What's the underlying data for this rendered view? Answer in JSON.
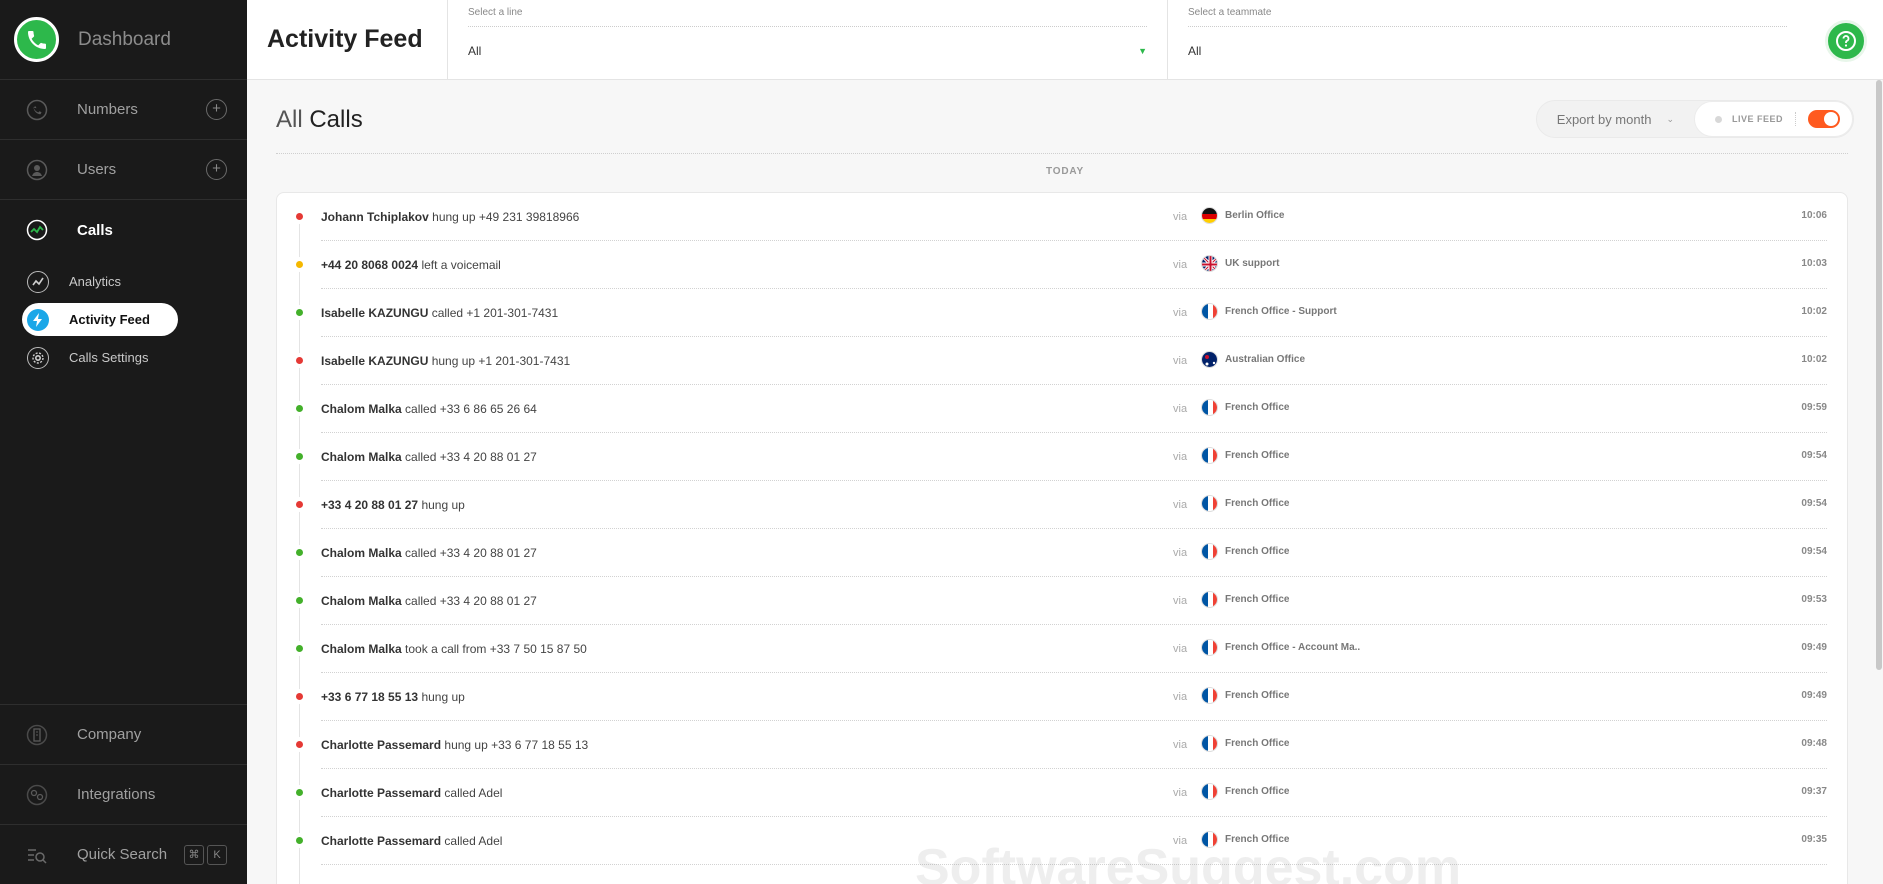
{
  "sidebar": {
    "brand": "Dashboard",
    "nav": {
      "numbers": "Numbers",
      "users": "Users",
      "calls": "Calls",
      "analytics": "Analytics",
      "activity_feed": "Activity Feed",
      "calls_settings": "Calls Settings",
      "company": "Company",
      "integrations": "Integrations",
      "quick_search": "Quick Search"
    },
    "shortcut_keys": [
      "⌘",
      "K"
    ]
  },
  "header": {
    "title": "Activity Feed",
    "line_filter": {
      "label": "Select a line",
      "value": "All"
    },
    "teammate_filter": {
      "label": "Select a teammate",
      "value": "All"
    }
  },
  "main": {
    "title_prefix": "All",
    "title_main": "Calls",
    "export_label": "Export by month",
    "live_feed_label": "LIVE FEED",
    "live_feed_on": true,
    "section_label": "TODAY",
    "watermark": "SoftwareSuggest.com"
  },
  "colors": {
    "accent_green": "#2db84b",
    "hung_up_red": "#e53935",
    "voicemail_yellow": "#f5b800",
    "called_green": "#43b02a",
    "toggle_orange": "#ff5a1f"
  },
  "calls": [
    {
      "status": "red",
      "actor": "Johann Tchiplakov",
      "action": "hung up +49 231 39818966",
      "via": "via",
      "flag": "de",
      "line": "Berlin Office",
      "time": "10:06"
    },
    {
      "status": "yellow",
      "actor": "+44 20 8068 0024",
      "action": "left a voicemail",
      "via": "via",
      "flag": "gb",
      "line": "UK support",
      "time": "10:03"
    },
    {
      "status": "green",
      "actor": "Isabelle KAZUNGU",
      "action": "called +1 201-301-7431",
      "via": "via",
      "flag": "fr",
      "line": "French Office - Support",
      "time": "10:02"
    },
    {
      "status": "red",
      "actor": "Isabelle KAZUNGU",
      "action": "hung up +1 201-301-7431",
      "via": "via",
      "flag": "au",
      "line": "Australian Office",
      "time": "10:02"
    },
    {
      "status": "green",
      "actor": "Chalom Malka",
      "action": "called +33 6 86 65 26 64",
      "via": "via",
      "flag": "fr",
      "line": "French Office",
      "time": "09:59"
    },
    {
      "status": "green",
      "actor": "Chalom Malka",
      "action": "called +33 4 20 88 01 27",
      "via": "via",
      "flag": "fr",
      "line": "French Office",
      "time": "09:54"
    },
    {
      "status": "red",
      "actor": "+33 4 20 88 01 27",
      "action": "hung up",
      "via": "via",
      "flag": "fr",
      "line": "French Office",
      "time": "09:54"
    },
    {
      "status": "green",
      "actor": "Chalom Malka",
      "action": "called +33 4 20 88 01 27",
      "via": "via",
      "flag": "fr",
      "line": "French Office",
      "time": "09:54"
    },
    {
      "status": "green",
      "actor": "Chalom Malka",
      "action": "called +33 4 20 88 01 27",
      "via": "via",
      "flag": "fr",
      "line": "French Office",
      "time": "09:53"
    },
    {
      "status": "green",
      "actor": "Chalom Malka",
      "action": "took a call from +33 7 50 15 87 50",
      "via": "via",
      "flag": "fr",
      "line": "French Office - Account Ma..",
      "time": "09:49"
    },
    {
      "status": "red",
      "actor": "+33 6 77 18 55 13",
      "action": "hung up",
      "via": "via",
      "flag": "fr",
      "line": "French Office",
      "time": "09:49"
    },
    {
      "status": "red",
      "actor": "Charlotte Passemard",
      "action": "hung up +33 6 77 18 55 13",
      "via": "via",
      "flag": "fr",
      "line": "French Office",
      "time": "09:48"
    },
    {
      "status": "green",
      "actor": "Charlotte Passemard",
      "action": "called Adel",
      "via": "via",
      "flag": "fr",
      "line": "French Office",
      "time": "09:37"
    },
    {
      "status": "green",
      "actor": "Charlotte Passemard",
      "action": "called Adel",
      "via": "via",
      "flag": "fr",
      "line": "French Office",
      "time": "09:35"
    }
  ]
}
